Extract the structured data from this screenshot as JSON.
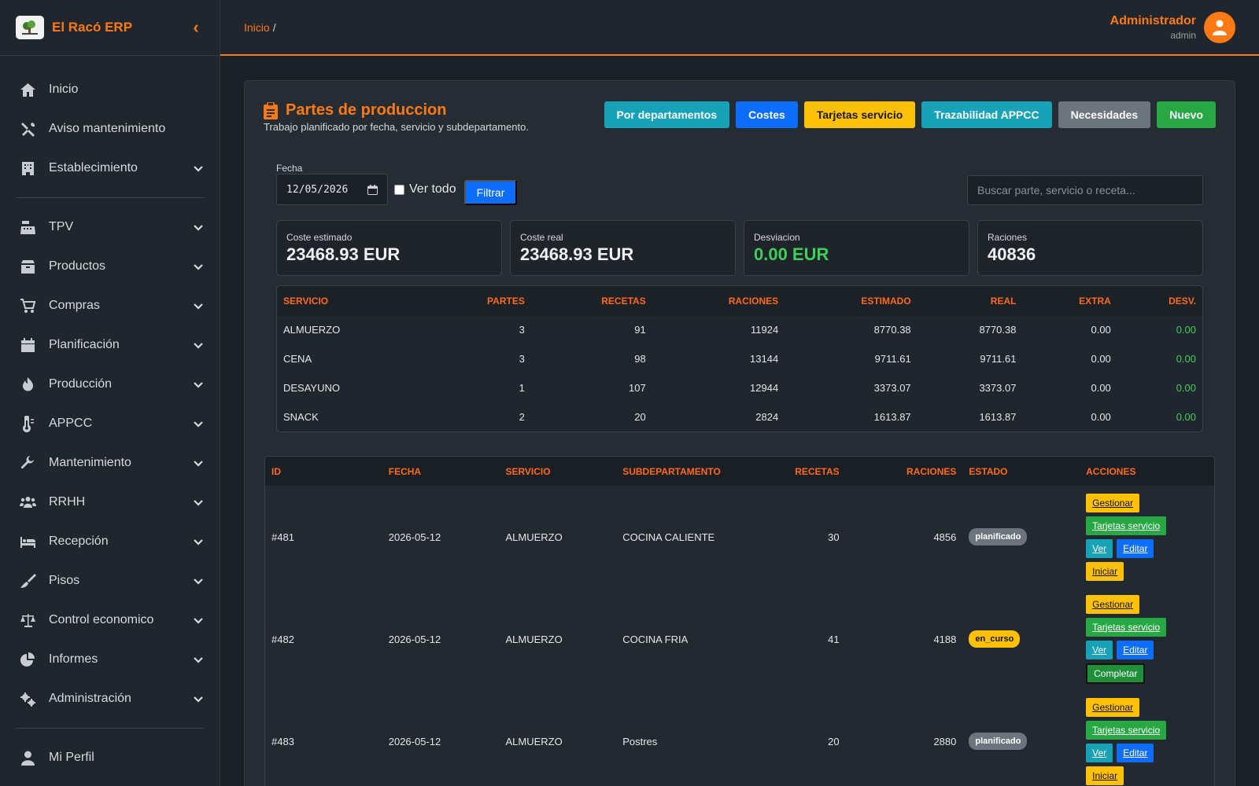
{
  "app": {
    "name": "El Racó ERP"
  },
  "sidebar": {
    "items": [
      {
        "label": "Inicio",
        "icon": "home-icon",
        "expand": false
      },
      {
        "label": "Aviso mantenimiento",
        "icon": "tools-icon",
        "expand": false
      },
      {
        "label": "Establecimiento",
        "icon": "building-icon",
        "expand": true
      },
      {
        "label": "TPV",
        "icon": "cash-register-icon",
        "expand": true
      },
      {
        "label": "Productos",
        "icon": "box-icon",
        "expand": true
      },
      {
        "label": "Compras",
        "icon": "cart-icon",
        "expand": true
      },
      {
        "label": "Planificación",
        "icon": "calendar-icon",
        "expand": true
      },
      {
        "label": "Producción",
        "icon": "fire-icon",
        "expand": true
      },
      {
        "label": "APPCC",
        "icon": "thermometer-icon",
        "expand": true
      },
      {
        "label": "Mantenimiento",
        "icon": "wrench-icon",
        "expand": true
      },
      {
        "label": "RRHH",
        "icon": "users-icon",
        "expand": true
      },
      {
        "label": "Recepción",
        "icon": "bed-icon",
        "expand": true
      },
      {
        "label": "Pisos",
        "icon": "broom-icon",
        "expand": true
      },
      {
        "label": "Control economico",
        "icon": "scale-icon",
        "expand": true
      },
      {
        "label": "Informes",
        "icon": "pie-chart-icon",
        "expand": true
      },
      {
        "label": "Administración",
        "icon": "gears-icon",
        "expand": true
      },
      {
        "label": "Mi Perfil",
        "icon": "user-icon",
        "expand": false
      }
    ]
  },
  "topbar": {
    "breadcrumb": "Inicio",
    "breadcrumb_sep": "/",
    "user_name": "Administrador",
    "user_role": "admin"
  },
  "page": {
    "title": "Partes de produccion",
    "subtitle": "Trabajo planificado por fecha, servicio y subdepartamento.",
    "buttons": {
      "departamentos": "Por departamentos",
      "costes": "Costes",
      "tarjetas": "Tarjetas servicio",
      "trazabilidad": "Trazabilidad APPCC",
      "necesidades": "Necesidades",
      "nuevo": "Nuevo"
    }
  },
  "filter": {
    "date_label": "Fecha",
    "date_value": "12/05/2026",
    "ver_todo_label": "Ver todo",
    "filter_button": "Filtrar",
    "search_placeholder": "Buscar parte, servicio o receta..."
  },
  "stats": [
    {
      "label": "Coste estimado",
      "value": "23468.93 EUR"
    },
    {
      "label": "Coste real",
      "value": "23468.93 EUR"
    },
    {
      "label": "Desviacion",
      "value": "0.00 EUR"
    },
    {
      "label": "Raciones",
      "value": "40836"
    }
  ],
  "summary": {
    "headers": [
      "SERVICIO",
      "PARTES",
      "RECETAS",
      "RACIONES",
      "ESTIMADO",
      "REAL",
      "EXTRA",
      "DESV."
    ],
    "rows": [
      [
        "ALMUERZO",
        "3",
        "91",
        "11924",
        "8770.38",
        "8770.38",
        "0.00",
        "0.00"
      ],
      [
        "CENA",
        "3",
        "98",
        "13144",
        "9711.61",
        "9711.61",
        "0.00",
        "0.00"
      ],
      [
        "DESAYUNO",
        "1",
        "107",
        "12944",
        "3373.07",
        "3373.07",
        "0.00",
        "0.00"
      ],
      [
        "SNACK",
        "2",
        "20",
        "2824",
        "1613.87",
        "1613.87",
        "0.00",
        "0.00"
      ]
    ]
  },
  "parts": {
    "headers": [
      "ID",
      "FECHA",
      "SERVICIO",
      "SUBDEPARTAMENTO",
      "RECETAS",
      "RACIONES",
      "ESTADO",
      "ACCIONES"
    ],
    "action_labels": {
      "gestionar": "Gestionar",
      "tarjetas": "Tarjetas servicio",
      "ver": "Ver",
      "editar": "Editar",
      "iniciar": "Iniciar",
      "completar": "Completar"
    },
    "rows": [
      {
        "id": "#481",
        "fecha": "2026-05-12",
        "servicio": "ALMUERZO",
        "sub": "COCINA CALIENTE",
        "recetas": "30",
        "raciones": "4856",
        "estado": "planificado"
      },
      {
        "id": "#482",
        "fecha": "2026-05-12",
        "servicio": "ALMUERZO",
        "sub": "COCINA FRIA",
        "recetas": "41",
        "raciones": "4188",
        "estado": "en_curso"
      },
      {
        "id": "#483",
        "fecha": "2026-05-12",
        "servicio": "ALMUERZO",
        "sub": "Postres",
        "recetas": "20",
        "raciones": "2880",
        "estado": "planificado"
      }
    ]
  },
  "colors": {
    "accent": "#ff7a14",
    "positive": "#3ecf5a"
  }
}
